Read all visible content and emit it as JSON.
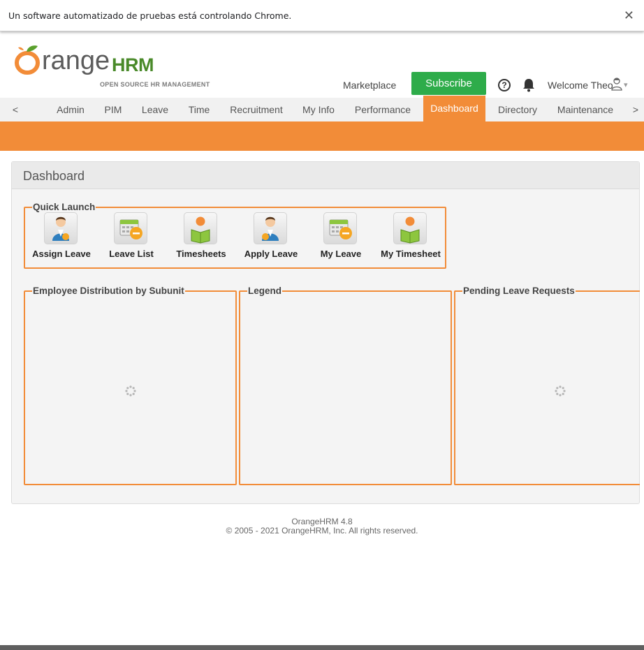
{
  "infobar": {
    "text": "Un software automatizado de pruebas está controlando Chrome.",
    "close": "✕"
  },
  "header": {
    "logo_o": "O",
    "logo_word": "range",
    "logo_hrm": "HRM",
    "logo_sub": "OPEN SOURCE HR MANAGEMENT",
    "marketplace": "Marketplace",
    "subscribe": "Subscribe",
    "help": "?",
    "welcome": "Welcome Theo",
    "caret": "▾"
  },
  "menu": {
    "prev": "<",
    "next": ">",
    "items": [
      "Admin",
      "PIM",
      "Leave",
      "Time",
      "Recruitment",
      "My Info",
      "Performance",
      "Dashboard",
      "Directory",
      "Maintenance"
    ],
    "active": "Dashboard"
  },
  "dashboard": {
    "title": "Dashboard",
    "quick_launch": {
      "legend": "Quick Launch",
      "items": [
        "Assign Leave",
        "Leave List",
        "Timesheets",
        "Apply Leave",
        "My Leave",
        "My Timesheet"
      ]
    },
    "widgets": {
      "distribution": "Employee Distribution by Subunit",
      "legend": "Legend",
      "pending": "Pending Leave Requests"
    }
  },
  "footer": {
    "version": "OrangeHRM 4.8",
    "copyright": "© 2005 - 2021 OrangeHRM, Inc. All rights reserved."
  },
  "colors": {
    "brand_orange": "#f28c38",
    "subscribe_green": "#2eac4a",
    "logo_green": "#4a8a2a"
  }
}
